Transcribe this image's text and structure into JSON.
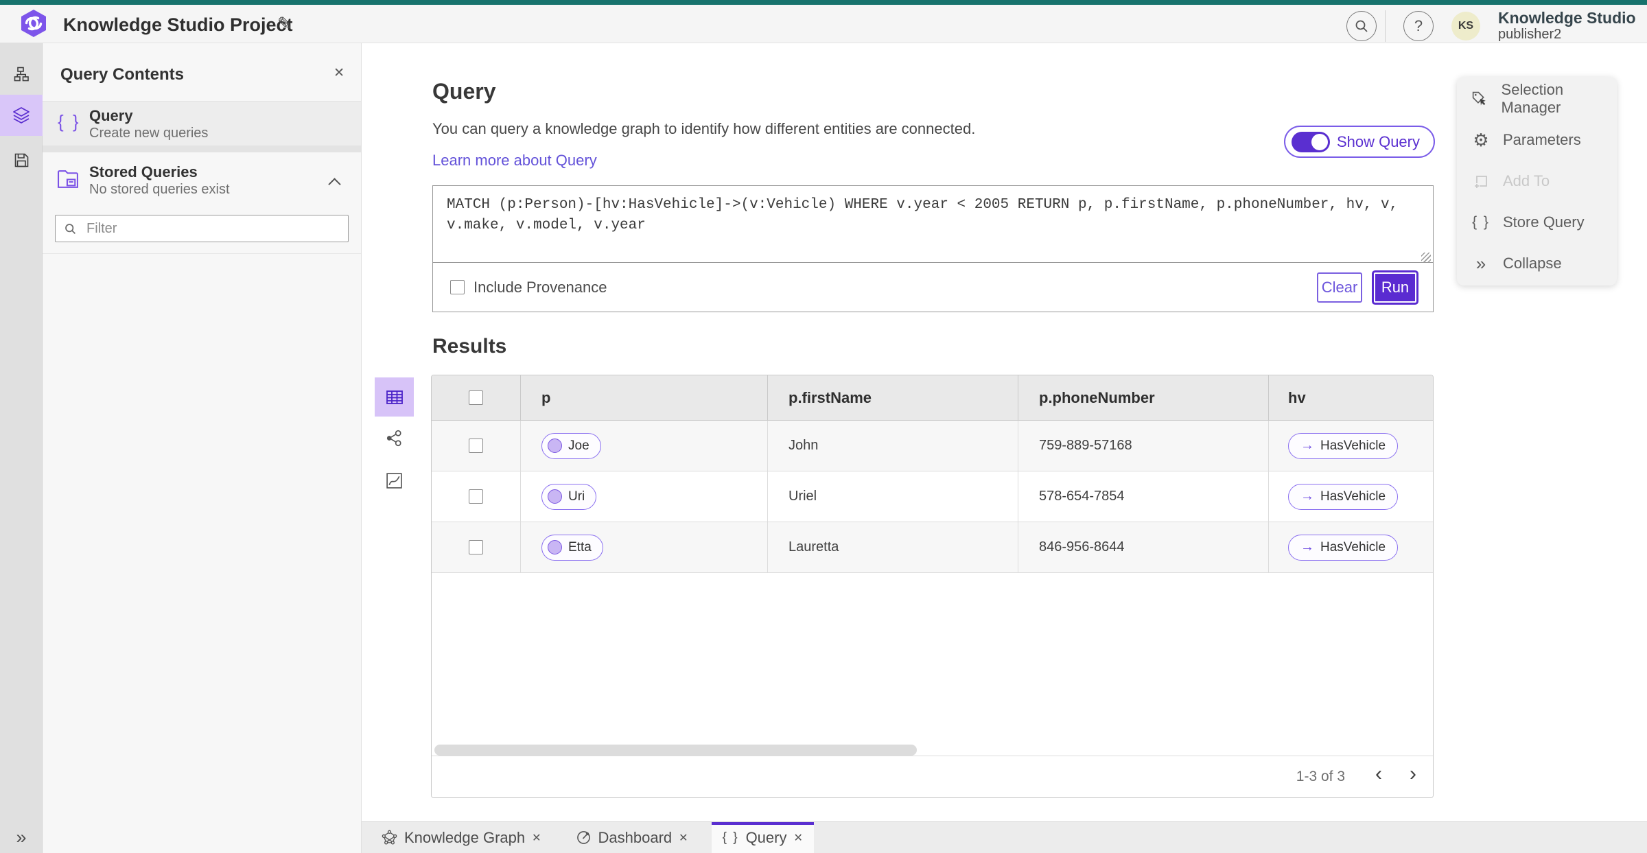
{
  "colors": {
    "accent": "#5a2fd0",
    "accent_soft": "#d9c6f9",
    "teal_bar": "#17736d",
    "link": "#6352d9",
    "run_button": "#5a2bd1"
  },
  "header": {
    "title": "Knowledge Studio Project",
    "product": "Knowledge Studio",
    "username": "publisher2",
    "avatar_initials": "KS"
  },
  "panel": {
    "title": "Query Contents",
    "query": {
      "title": "Query",
      "subtitle": "Create new queries"
    },
    "stored": {
      "title": "Stored Queries",
      "subtitle": "No stored queries exist"
    },
    "filter_placeholder": "Filter"
  },
  "query_section": {
    "title": "Query",
    "description": "You can query a knowledge graph to identify how different entities are connected.",
    "learn_more": "Learn more about Query",
    "show_query": "Show Query",
    "query_text": "MATCH (p:Person)-[hv:HasVehicle]->(v:Vehicle) WHERE v.year < 2005 RETURN p, p.firstName, p.phoneNumber, hv, v,\nv.make, v.model, v.year",
    "include_provenance": "Include Provenance",
    "clear": "Clear",
    "run": "Run"
  },
  "results": {
    "title": "Results",
    "columns": [
      "p",
      "p.firstName",
      "p.phoneNumber",
      "hv"
    ],
    "rows": [
      {
        "p": "Joe",
        "firstName": "John",
        "phone": "759-889-57168",
        "hv": "HasVehicle"
      },
      {
        "p": "Uri",
        "firstName": "Uriel",
        "phone": "578-654-7854",
        "hv": "HasVehicle"
      },
      {
        "p": "Etta",
        "firstName": "Lauretta",
        "phone": "846-956-8644",
        "hv": "HasVehicle"
      }
    ],
    "pagination": "1-3 of 3"
  },
  "tools": {
    "items": [
      {
        "label": "Selection Manager"
      },
      {
        "label": "Parameters"
      },
      {
        "label": "Add To"
      },
      {
        "label": "Store Query"
      },
      {
        "label": "Collapse"
      }
    ]
  },
  "tabs": [
    {
      "label": "Knowledge Graph"
    },
    {
      "label": "Dashboard"
    },
    {
      "label": "Query"
    }
  ],
  "glyphs": {
    "pencil": "✎",
    "close": "✕",
    "question": "?",
    "braces": "{ }",
    "double_chevron": "»",
    "chevron_left": "‹",
    "chevron_right": "›",
    "arrow_right": "→",
    "gear": "⚙"
  }
}
